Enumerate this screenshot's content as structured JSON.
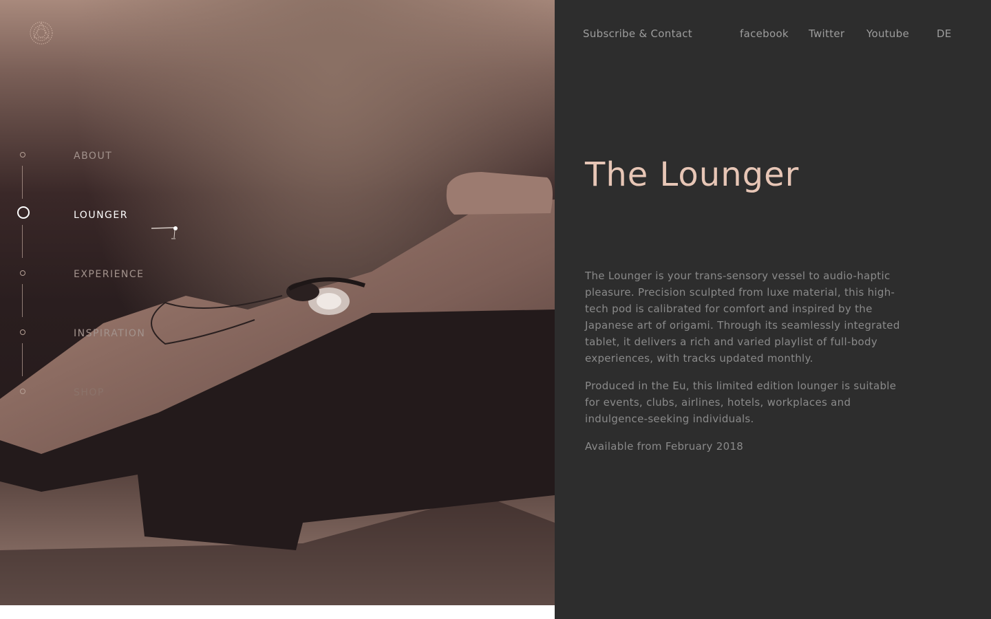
{
  "topnav": {
    "subscribe": "Subscribe & Contact",
    "facebook": "facebook",
    "twitter": "Twitter",
    "youtube": "Youtube",
    "language": "DE"
  },
  "sections": {
    "about": "ABOUT",
    "lounger": "LOUNGER",
    "experience": "EXPERIENCE",
    "inspiration": "INSPIRATION",
    "last_item": "SHOP",
    "active": "lounger"
  },
  "content": {
    "title": "The Lounger",
    "paragraph1": "The Lounger is your trans-sensory vessel to audio-haptic pleasure. Precision sculpted from luxe material, this high-tech pod is calibrated for comfort and inspired by the Japanese art of origami. Through its seamlessly integrated tablet, it delivers a rich and varied playlist of full-body experiences, with tracks updated monthly.",
    "paragraph2": "Produced in the Eu, this limited edition lounger is suitable for events, clubs, airlines, hotels, workplaces and indulgence-seeking individuals.",
    "availability": "Available from February 2018"
  },
  "colors": {
    "title_accent": "#e7c6b6",
    "panel_background": "#2d2d2d",
    "body_text": "#8a8a8a",
    "nav_text": "#9d9d9d"
  },
  "icons": {
    "logo": "lotus-logo-icon",
    "headphones": "headphones-image",
    "cursor": "pointer-cursor-icon"
  }
}
